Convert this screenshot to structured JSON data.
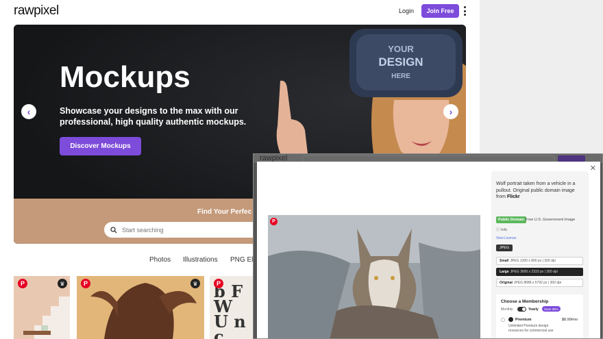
{
  "header": {
    "logo": "rawpixel",
    "login_label": "Login",
    "join_label": "Join Free"
  },
  "hero": {
    "title": "Mockups",
    "subtitle": "Showcase your designs to the max with our professional, high quality authentic mockups.",
    "button_label": "Discover Mockups",
    "find_label": "Find Your Perfec",
    "search_placeholder": "Start searching",
    "headset_text": [
      "YOUR",
      "DESIGN",
      "HERE"
    ]
  },
  "categories": [
    "Photos",
    "Illustrations",
    "PNG El"
  ],
  "thumbnail_letters": "b F W U n c",
  "modal": {
    "bg_logo": "rawpixel",
    "description_prefix": "Wolf portrait taken from a vehicle in a pullout. Original public domain image from ",
    "description_source": "Flickr",
    "badge": "Public Domain",
    "badge_note": "Free U.S. Government Image",
    "info": "Info",
    "license_link": "View License",
    "format": "JPEG",
    "options": [
      {
        "name": "Small",
        "detail": "JPEG 1200 x 800 px | 300 dpi"
      },
      {
        "name": "Large",
        "detail": "JPEG 3600 x 2333 px | 300 dpi"
      },
      {
        "name": "Original",
        "detail": "JPEG 8688 x 5792 px | 300 dpi"
      }
    ],
    "membership": {
      "title": "Choose a Membership",
      "monthly": "Monthly",
      "yearly": "Yearly",
      "save": "Save 30%",
      "plan_name": "Premium",
      "plan_price": "$8.99/mo",
      "plan_desc": "Unlimited Premium design resources for commercial use"
    }
  },
  "colors": {
    "accent": "#7d4cdb",
    "hero_band": "#c49a7a",
    "pinterest": "#e60023"
  }
}
